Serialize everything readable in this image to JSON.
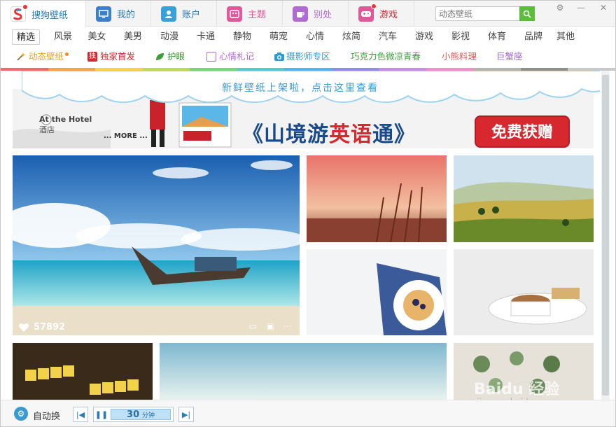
{
  "tabs": [
    {
      "label": "搜狗壁纸",
      "icon": "sogou-logo-icon",
      "color": "#ffffff",
      "active": true
    },
    {
      "label": "我的",
      "icon": "monitor-icon",
      "color": "#3a7fc9",
      "active": false
    },
    {
      "label": "账户",
      "icon": "user-icon",
      "color": "#3aa0d8",
      "active": false
    },
    {
      "label": "主题",
      "icon": "theme-icon",
      "color": "#e0579a",
      "active": false
    },
    {
      "label": "别处",
      "icon": "cup-icon",
      "color": "#b06ad3",
      "active": false
    },
    {
      "label": "游戏",
      "icon": "gamepad-icon",
      "color": "#e0579a",
      "active": false
    }
  ],
  "search": {
    "placeholder": "动态壁纸"
  },
  "categories": [
    "精选",
    "风景",
    "美女",
    "美男",
    "动漫",
    "卡通",
    "静物",
    "萌宠",
    "心情",
    "炫简",
    "汽车",
    "游戏",
    "影视",
    "体育",
    "品牌",
    "其他"
  ],
  "features": [
    {
      "label": "动态壁纸",
      "color": "#e8a11c"
    },
    {
      "label": "独家首发",
      "color": "#d7272f"
    },
    {
      "label": "护眼",
      "color": "#2f9a2f"
    },
    {
      "label": "心情札记",
      "color": "#b06ad3"
    },
    {
      "label": "摄影师专区",
      "color": "#2b9bd8"
    },
    {
      "label": "巧克力色微凉青春",
      "color": "#3aa03a"
    },
    {
      "label": "小熊料理",
      "color": "#e05a5a"
    },
    {
      "label": "巨蟹座",
      "color": "#9b6ad3"
    }
  ],
  "cloud_notice": "新鲜壁纸上架啦，点击这里查看",
  "banner": {
    "hotel_en": "At the Hotel",
    "hotel_cn": "酒店",
    "more": "... MORE ...",
    "title_pre": "《山境游",
    "title_red": "英语",
    "title_post": "通》",
    "cta": "免费获赠"
  },
  "featured_tile": {
    "likes": "57892"
  },
  "bottom": {
    "auto_label": "自动换",
    "timer_value": "30",
    "timer_unit": "分钟"
  },
  "watermark": {
    "main": "Baidu 经验",
    "sub": "jingyan.baidu.com"
  },
  "colors": {
    "strip": [
      "#ef6a6a",
      "#f4a34a",
      "#f6d24a",
      "#b8dc5a",
      "#7fd17f",
      "#5ec8c8",
      "#5cb2e8",
      "#8f8fe0",
      "#c48fe0",
      "#ef8fc8",
      "#b3b3b3",
      "#8f8f8f",
      "#c8c8c8"
    ],
    "accent": "#3a9bd3"
  }
}
